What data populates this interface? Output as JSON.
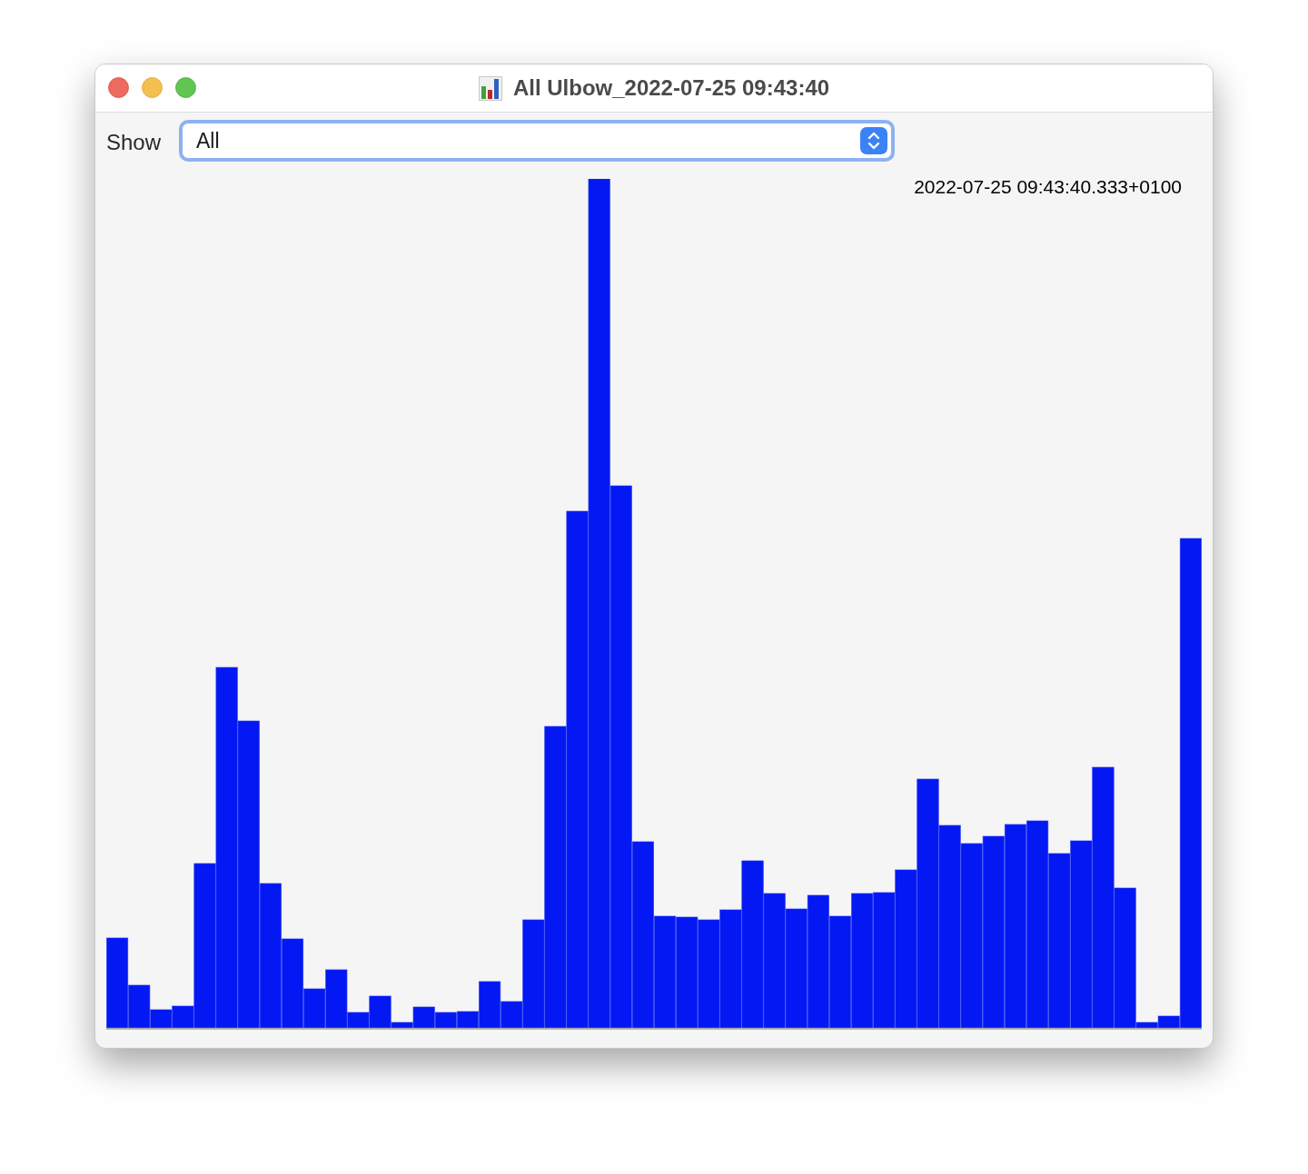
{
  "window": {
    "title": "All Ulbow_2022-07-25 09:43:40"
  },
  "toolbar": {
    "label": "Show",
    "dropdown": {
      "value": "All"
    }
  },
  "chart": {
    "timestamp": "2022-07-25 09:43:40.333+0100"
  }
}
